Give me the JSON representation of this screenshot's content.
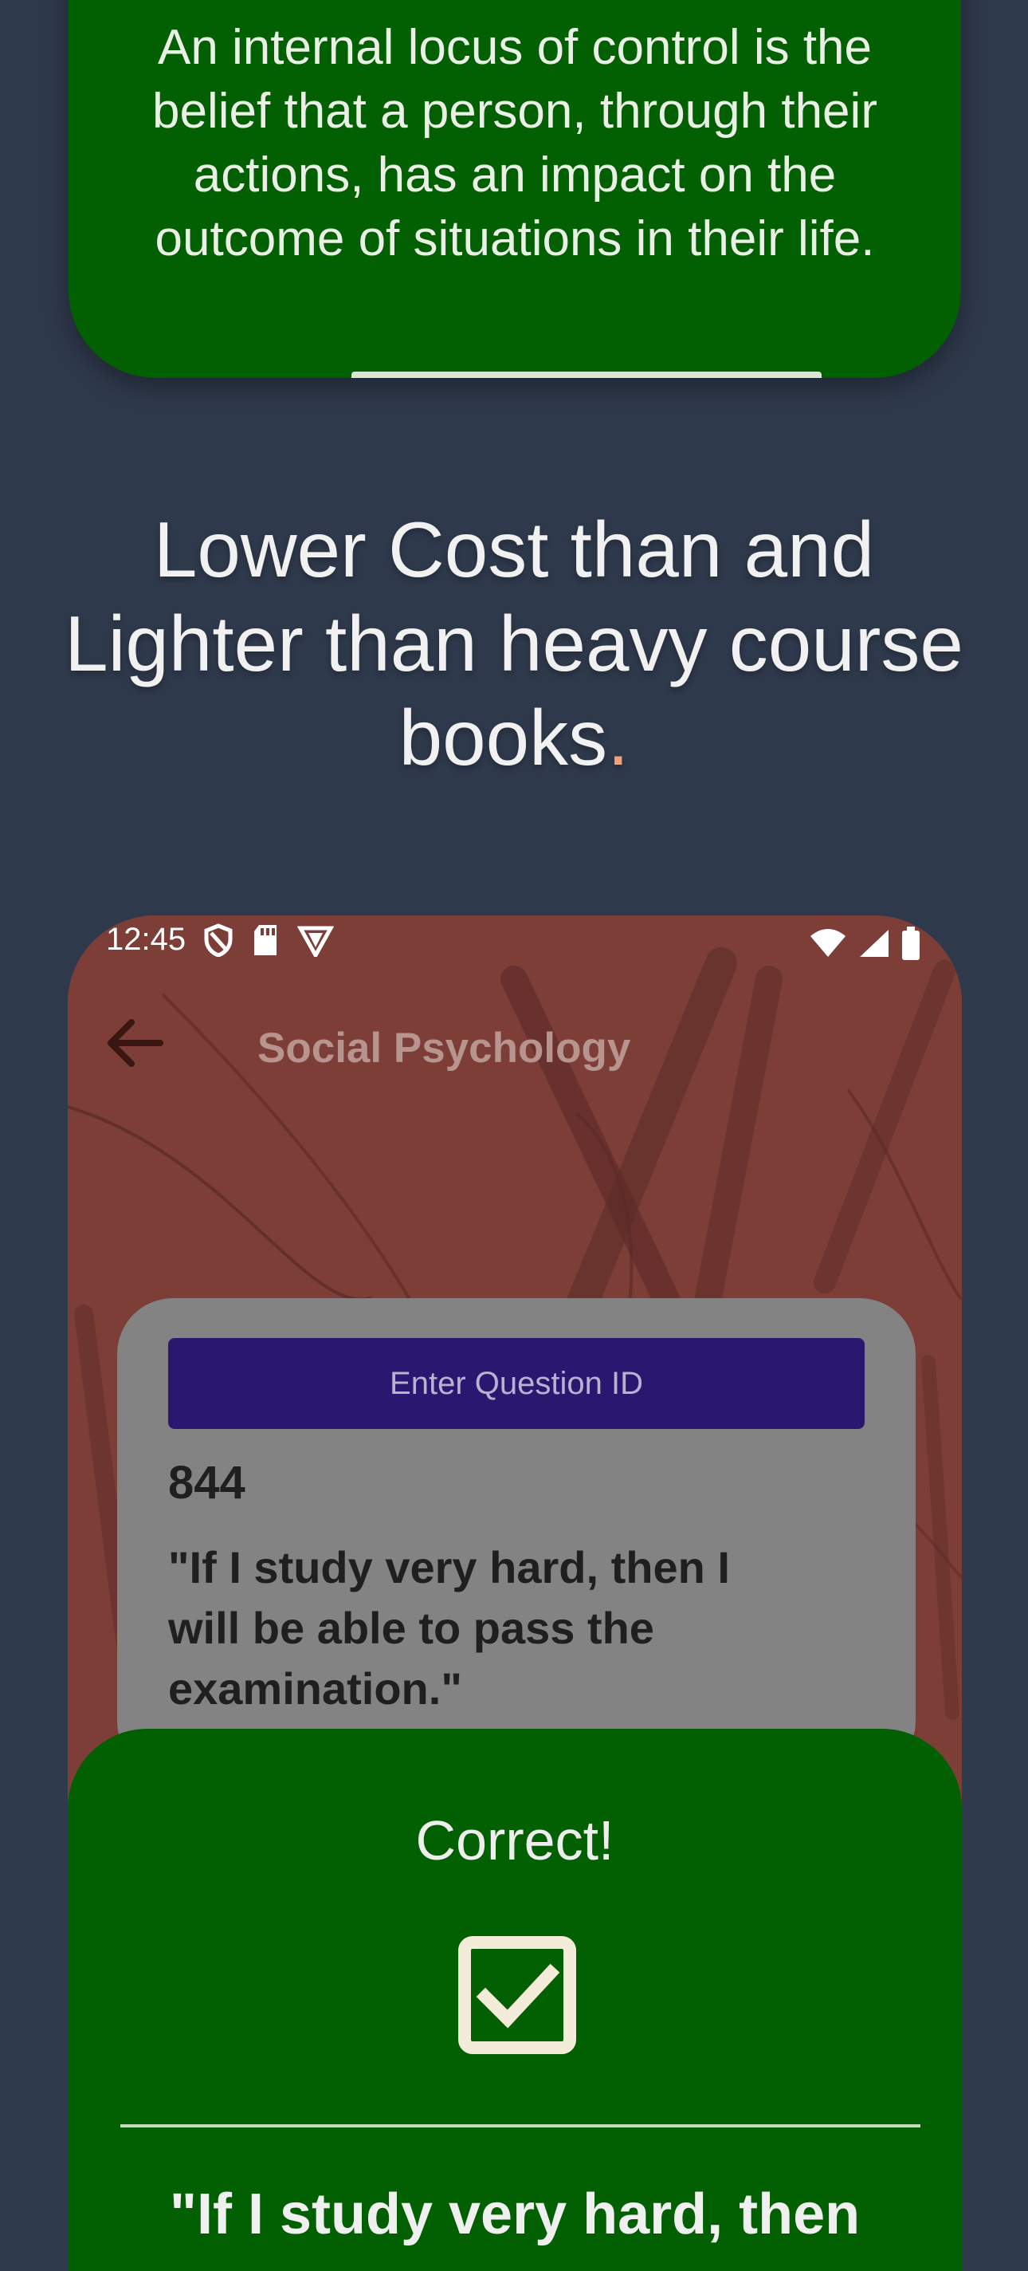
{
  "explanation_card": {
    "text": "An internal locus of control is the belief that a person, through their actions, has an impact on the outcome of situations in their life."
  },
  "headline": {
    "text": "Lower Cost than and Lighter than heavy course books",
    "punctuation": "."
  },
  "phone": {
    "status_bar": {
      "time": "12:45",
      "left_icons": [
        "shield-icon",
        "sd-card-icon",
        "vpn-shield-icon"
      ],
      "right_icons": [
        "wifi-icon",
        "cell-signal-icon",
        "battery-icon"
      ]
    },
    "app_bar": {
      "back_icon": "back-arrow-icon",
      "title": "Social Psychology"
    },
    "question_card": {
      "enter_id_label": "Enter Question ID",
      "question_id": "844",
      "question_text": "\"If I study very hard, then I will be able to pass the examination.\""
    },
    "result_panel": {
      "title": "Correct!",
      "icon": "checkbox-checked-icon",
      "quote_preview": "\"If I study very hard, then"
    }
  },
  "colors": {
    "page_background": "#2e394b",
    "card_green": "#026002",
    "phone_background": "#7d3e38",
    "button_purple": "#2a1870",
    "card_gray": "#838383"
  }
}
